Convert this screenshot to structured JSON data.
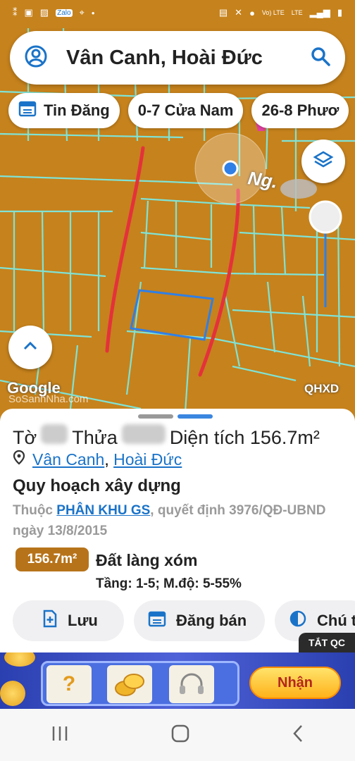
{
  "status_bar": {
    "left_icons": [
      "notification-icon",
      "gallery-icon",
      "image-icon",
      "zalo-icon",
      "location-icon"
    ],
    "zalo": "Zalo",
    "right_text": "Vo) LTE",
    "right_text2": "LTE"
  },
  "search": {
    "title": "Vân Canh, Hoài Đức"
  },
  "chips": [
    {
      "label": "Tin Đăng",
      "icon": "calendar-icon"
    },
    {
      "label": "0-7 Cửa Nam"
    },
    {
      "label": "26-8 Phươ",
      "icon": "pin-icon"
    }
  ],
  "map": {
    "street_label": "Ng.",
    "google": "Google",
    "watermark": "SoSanhNha.com",
    "layer_code": "QHXD"
  },
  "sheet": {
    "to_label": "Tờ",
    "thua_label": "Thửa",
    "area_label": "Diện tích 156.7m²",
    "location_commune": "Vân Canh",
    "location_sep": ",",
    "location_district": "Hoài Đức",
    "plan_title": "Quy hoạch xây dựng",
    "plan_desc_prefix": "Thuộc",
    "plan_desc_link": "PHÂN KHU GS",
    "plan_desc_suffix": ", quyết định 3976/QĐ-UBND ngày 13/8/2015",
    "area_badge": "156.7m²",
    "land_type": "Đất làng xóm",
    "land_detail": "Tầng: 1-5; M.độ: 5-55%",
    "actions": [
      {
        "label": "Lưu",
        "icon": "save-icon"
      },
      {
        "label": "Đăng bán",
        "icon": "calendar-icon"
      },
      {
        "label": "Chú t",
        "icon": "contrast-icon"
      }
    ]
  },
  "ad": {
    "close_label": "TẮT QC",
    "tile1": "?",
    "cta": "Nhận"
  },
  "colors": {
    "map_bg": "#c6821c",
    "parcel_lines": "#7fe3d6",
    "highlight_parcel": "#2f7fe6",
    "boundary": "#e5313c",
    "accent": "#1a73c8"
  }
}
